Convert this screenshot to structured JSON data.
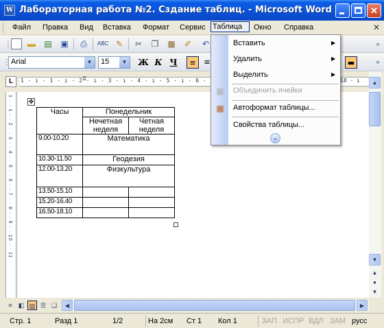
{
  "window": {
    "icon_letter": "W",
    "title": "Лабораторная работа №2. Сздание таблиц. - Microsoft Word"
  },
  "menubar": {
    "items": [
      "Файл",
      "Правка",
      "Вид",
      "Вставка",
      "Формат",
      "Сервис",
      "Таблица",
      "Окно",
      "Справка"
    ],
    "open": "Таблица"
  },
  "format_toolbar": {
    "font": "Arial",
    "size": "15",
    "bold": "Ж",
    "italic": "К",
    "underline": "Ч"
  },
  "ruler": {
    "numbers": "1 · ı · 1 · ı · 2 · ı · 3 · ı · 4 · ı · 5 · ı · 6 · ı · 7 · ı · 8 · ı · 9 · ı · 10",
    "right_number": "18 · ı",
    "vertical_numbers": "1 · · 1 · · 2 · · 3 · · 4 · · 5 · · 6 · · 7 · · 8 · · 9 · · 10 · · 11"
  },
  "table_menu": {
    "items": [
      {
        "label": "Вставить",
        "submenu": true,
        "disabled": false
      },
      {
        "label": "Удалить",
        "submenu": true,
        "disabled": false
      },
      {
        "label": "Выделить",
        "submenu": true,
        "disabled": false
      },
      {
        "label": "Объединить ячейки",
        "submenu": false,
        "disabled": true
      },
      {
        "label": "Автоформат таблицы...",
        "submenu": false,
        "disabled": false
      },
      {
        "label": "Свойства таблицы...",
        "submenu": false,
        "disabled": false
      }
    ],
    "more_icon": "double-chevron-down"
  },
  "document_table": {
    "header": {
      "hours": "Часы",
      "monday": "Понедельник",
      "odd_week": "Нечетная неделя",
      "even_week": "Четная неделя"
    },
    "rows": [
      {
        "time": "9.00-10.20",
        "subject": "Математика"
      },
      {
        "time": "10.30-11.50",
        "subject": "Геодезия"
      },
      {
        "time": "12.00-13.20",
        "subject": "Физкультура"
      },
      {
        "time": "13.50-15.10",
        "subject": ""
      },
      {
        "time": "15.20-16.40",
        "subject": ""
      },
      {
        "time": "16.50-18.10",
        "subject": ""
      }
    ]
  },
  "statusbar": {
    "page": "Стр. 1",
    "section": "Разд 1",
    "pages": "1/2",
    "at": "На 2см",
    "line": "Ст 1",
    "col": "Кол 1",
    "rec": "ЗАП",
    "trk": "ИСПР",
    "ext": "ВДЛ",
    "ovr": "ЗАМ",
    "lang": "русс"
  }
}
